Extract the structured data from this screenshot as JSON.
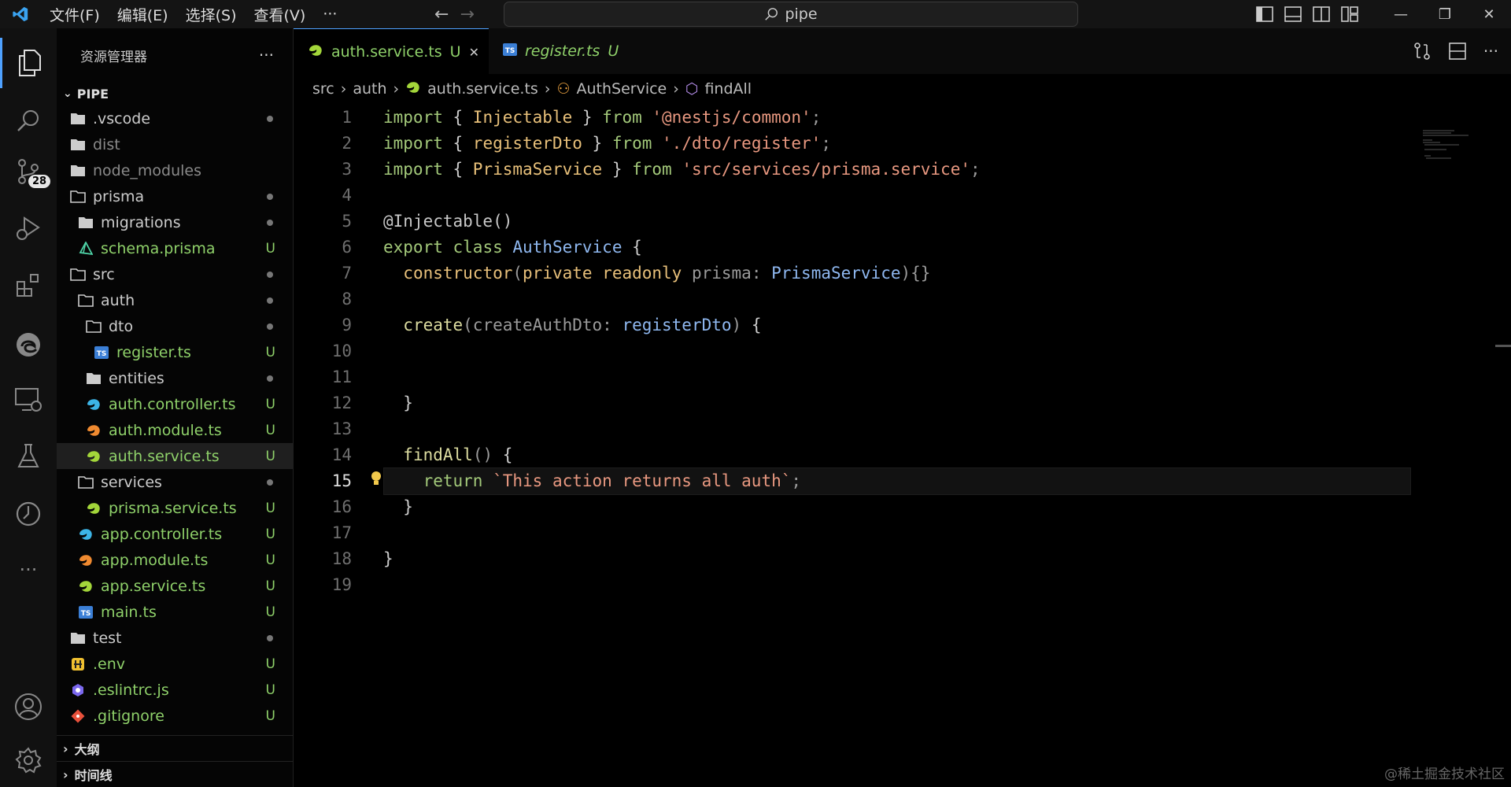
{
  "titlebar": {
    "menu": [
      "文件(F)",
      "编辑(E)",
      "选择(S)",
      "查看(V)",
      "···"
    ],
    "search_text": "pipe"
  },
  "activity": {
    "scm_badge": "28"
  },
  "sidebar": {
    "title": "资源管理器",
    "more": "···",
    "root": "PIPE",
    "items": [
      {
        "label": ".vscode",
        "indent": 0,
        "icon": "folder",
        "badge": "",
        "dot": true
      },
      {
        "label": "dist",
        "indent": 0,
        "icon": "folder",
        "badge": "",
        "dot": false,
        "dim": true
      },
      {
        "label": "node_modules",
        "indent": 0,
        "icon": "folder",
        "badge": "",
        "dot": false,
        "dim": true
      },
      {
        "label": "prisma",
        "indent": 0,
        "icon": "folder-open",
        "badge": "",
        "dot": true
      },
      {
        "label": "migrations",
        "indent": 1,
        "icon": "folder",
        "badge": "",
        "dot": true
      },
      {
        "label": "schema.prisma",
        "indent": 1,
        "icon": "prisma",
        "badge": "U",
        "dot": false
      },
      {
        "label": "src",
        "indent": 0,
        "icon": "folder-open",
        "badge": "",
        "dot": true
      },
      {
        "label": "auth",
        "indent": 1,
        "icon": "folder-open",
        "badge": "",
        "dot": true
      },
      {
        "label": "dto",
        "indent": 2,
        "icon": "folder-open",
        "badge": "",
        "dot": true
      },
      {
        "label": "register.ts",
        "indent": 3,
        "icon": "ts",
        "badge": "U",
        "dot": false
      },
      {
        "label": "entities",
        "indent": 2,
        "icon": "folder",
        "badge": "",
        "dot": true
      },
      {
        "label": "auth.controller.ts",
        "indent": 2,
        "icon": "nest-blue",
        "badge": "U",
        "dot": false
      },
      {
        "label": "auth.module.ts",
        "indent": 2,
        "icon": "nest-orange",
        "badge": "U",
        "dot": false
      },
      {
        "label": "auth.service.ts",
        "indent": 2,
        "icon": "nest-green",
        "badge": "U",
        "dot": false,
        "selected": true
      },
      {
        "label": "services",
        "indent": 1,
        "icon": "folder-open",
        "badge": "",
        "dot": true
      },
      {
        "label": "prisma.service.ts",
        "indent": 2,
        "icon": "nest-green",
        "badge": "U",
        "dot": false
      },
      {
        "label": "app.controller.ts",
        "indent": 1,
        "icon": "nest-blue",
        "badge": "U",
        "dot": false
      },
      {
        "label": "app.module.ts",
        "indent": 1,
        "icon": "nest-orange",
        "badge": "U",
        "dot": false
      },
      {
        "label": "app.service.ts",
        "indent": 1,
        "icon": "nest-green",
        "badge": "U",
        "dot": false
      },
      {
        "label": "main.ts",
        "indent": 1,
        "icon": "ts",
        "badge": "U",
        "dot": false
      },
      {
        "label": "test",
        "indent": 0,
        "icon": "folder",
        "badge": "",
        "dot": true
      },
      {
        "label": ".env",
        "indent": 0,
        "icon": "env",
        "badge": "U",
        "dot": false
      },
      {
        "label": ".eslintrc.js",
        "indent": 0,
        "icon": "eslint",
        "badge": "U",
        "dot": false
      },
      {
        "label": ".gitignore",
        "indent": 0,
        "icon": "git",
        "badge": "U",
        "dot": false
      }
    ],
    "outline": "大纲",
    "timeline": "时间线"
  },
  "tabs": [
    {
      "label": "auth.service.ts",
      "status": "U",
      "active": true,
      "icon": "nest-green"
    },
    {
      "label": "register.ts",
      "status": "U",
      "active": false,
      "icon": "ts"
    }
  ],
  "breadcrumb": [
    "src",
    "auth",
    "auth.service.ts",
    "AuthService",
    "findAll"
  ],
  "code_lines": [
    [
      [
        "kw",
        "import"
      ],
      [
        "br",
        " { "
      ],
      [
        "cl",
        "Injectable"
      ],
      [
        "br",
        " } "
      ],
      [
        "kw",
        "from"
      ],
      [
        "str",
        " '@nestjs/common'"
      ],
      [
        "pm",
        ";"
      ]
    ],
    [
      [
        "kw",
        "import"
      ],
      [
        "br",
        " { "
      ],
      [
        "cl",
        "registerDto"
      ],
      [
        "br",
        " } "
      ],
      [
        "kw",
        "from"
      ],
      [
        "str",
        " './dto/register'"
      ],
      [
        "pm",
        ";"
      ]
    ],
    [
      [
        "kw",
        "import"
      ],
      [
        "br",
        " { "
      ],
      [
        "cl",
        "PrismaService"
      ],
      [
        "br",
        " } "
      ],
      [
        "kw",
        "from"
      ],
      [
        "str",
        " 'src/services/prisma.service'"
      ],
      [
        "pm",
        ";"
      ]
    ],
    [],
    [
      [
        "dec",
        "@Injectable()"
      ]
    ],
    [
      [
        "kw",
        "export"
      ],
      [
        "br",
        " "
      ],
      [
        "kw",
        "class"
      ],
      [
        "br",
        " "
      ],
      [
        "ty",
        "AuthService"
      ],
      [
        "br",
        " {"
      ]
    ],
    [
      [
        "br",
        "  "
      ],
      [
        "cl",
        "constructor"
      ],
      [
        "pm",
        "("
      ],
      [
        "cl",
        "private readonly"
      ],
      [
        "pm",
        " prisma: "
      ],
      [
        "ty",
        "PrismaService"
      ],
      [
        "pm",
        "){}"
      ]
    ],
    [],
    [
      [
        "br",
        "  "
      ],
      [
        "fn",
        "create"
      ],
      [
        "pm",
        "(createAuthDto: "
      ],
      [
        "ty",
        "registerDto"
      ],
      [
        "pm",
        ") "
      ],
      [
        "br",
        "{"
      ]
    ],
    [],
    [],
    [
      [
        "br",
        "  }"
      ]
    ],
    [],
    [
      [
        "br",
        "  "
      ],
      [
        "fn",
        "findAll"
      ],
      [
        "pm",
        "() "
      ],
      [
        "br",
        "{"
      ]
    ],
    [
      [
        "br",
        "    "
      ],
      [
        "kw",
        "return"
      ],
      [
        "str",
        " `This action returns all auth`"
      ],
      [
        "pm",
        ";"
      ]
    ],
    [
      [
        "br",
        "  }"
      ]
    ],
    [],
    [
      [
        "br",
        "}"
      ]
    ],
    []
  ],
  "current_line": 15,
  "watermark": "@稀土掘金技术社区"
}
